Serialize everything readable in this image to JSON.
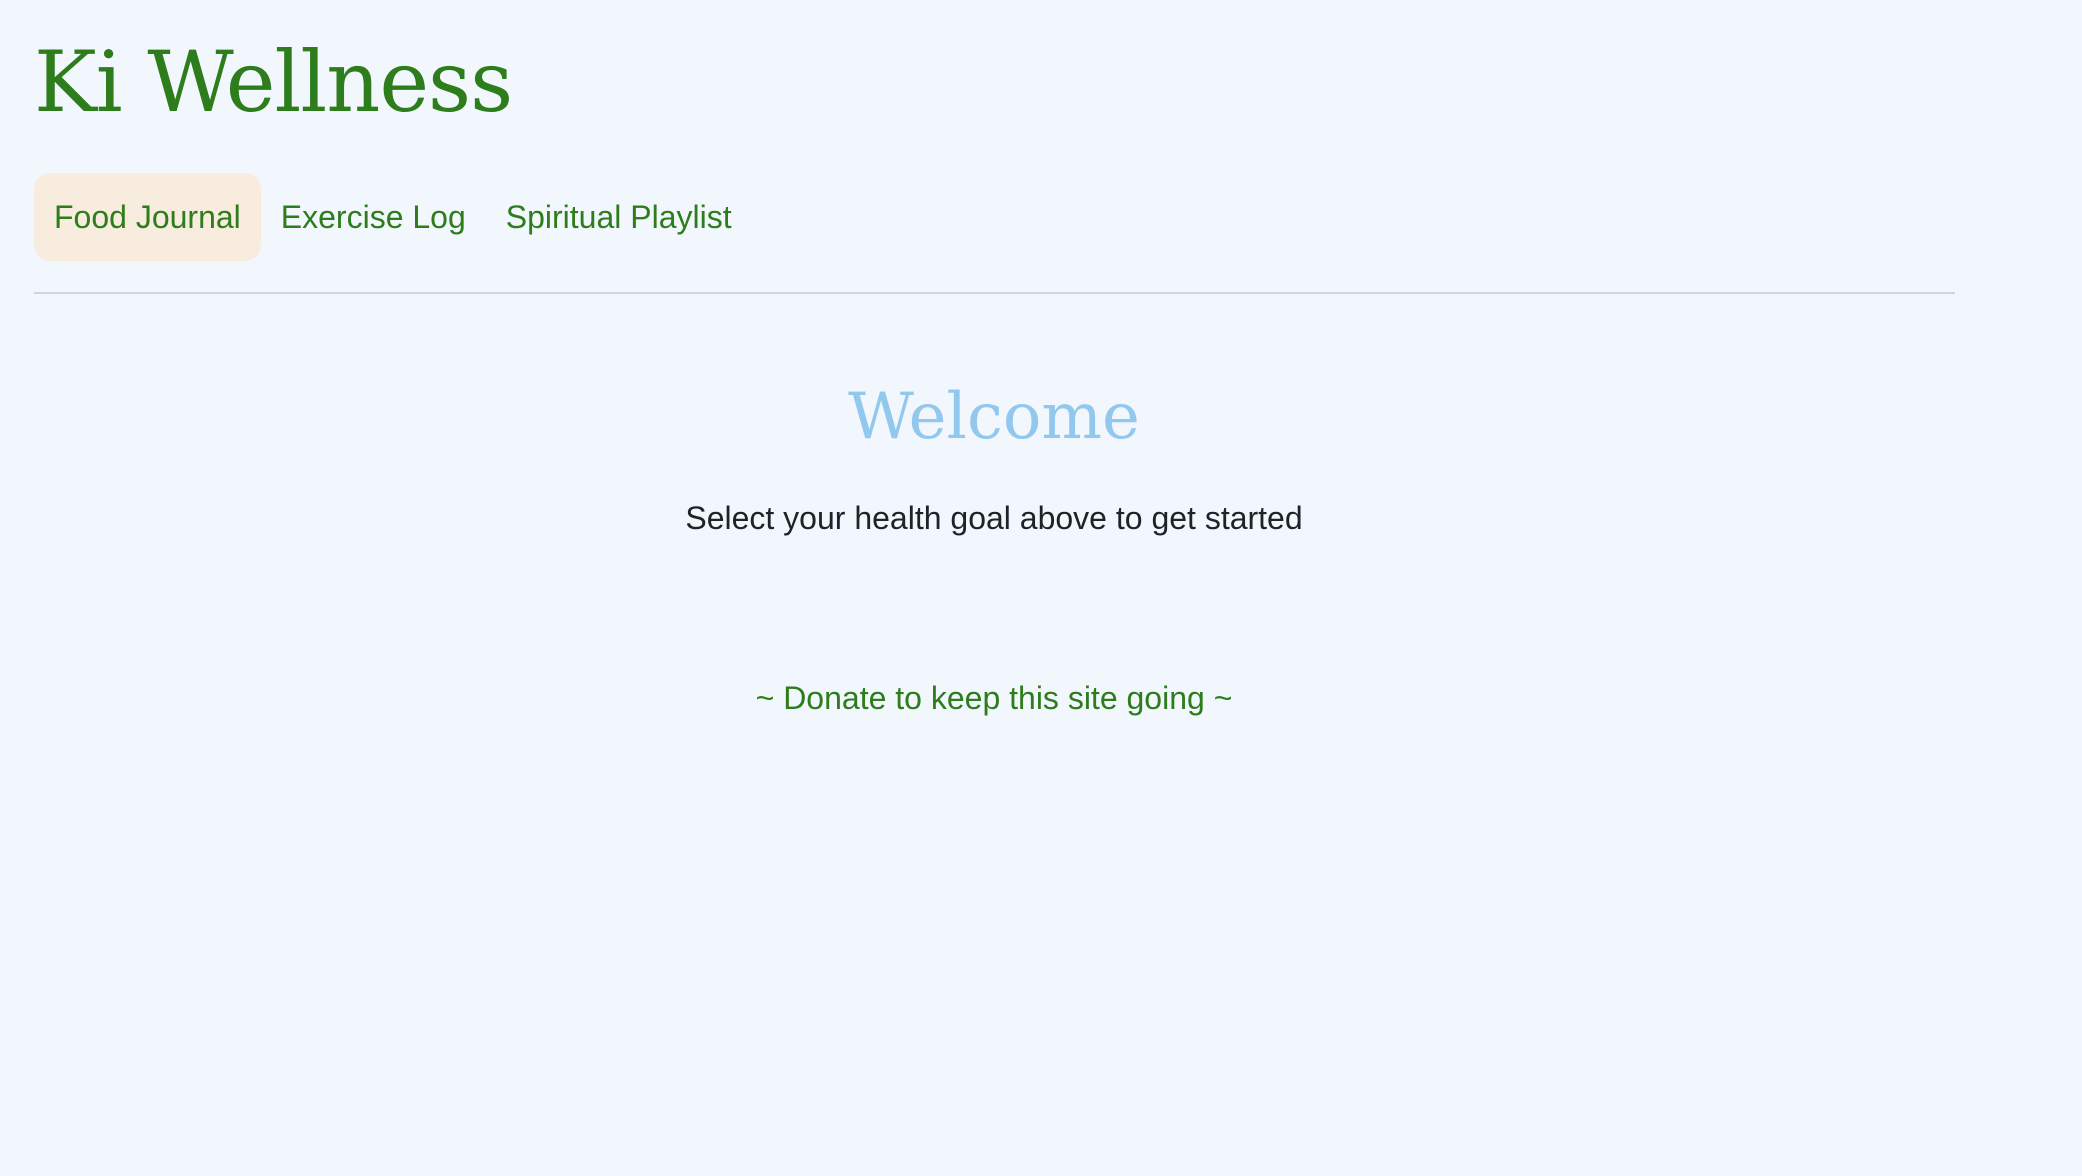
{
  "site": {
    "title": "Ki Wellness"
  },
  "nav": {
    "items": [
      {
        "label": "Food Journal",
        "active": true
      },
      {
        "label": "Exercise Log",
        "active": false
      },
      {
        "label": "Spiritual Playlist",
        "active": false
      }
    ]
  },
  "main": {
    "heading": "Welcome",
    "subtitle": "Select your health goal above to get started",
    "donate_link": "~ Donate to keep this site going ~"
  },
  "colors": {
    "background": "#f2f7fd",
    "brand_green": "#2e7d1c",
    "welcome_blue": "#93c8ee",
    "active_tab_bg": "#f7ecdd",
    "divider": "#cdd5de"
  }
}
